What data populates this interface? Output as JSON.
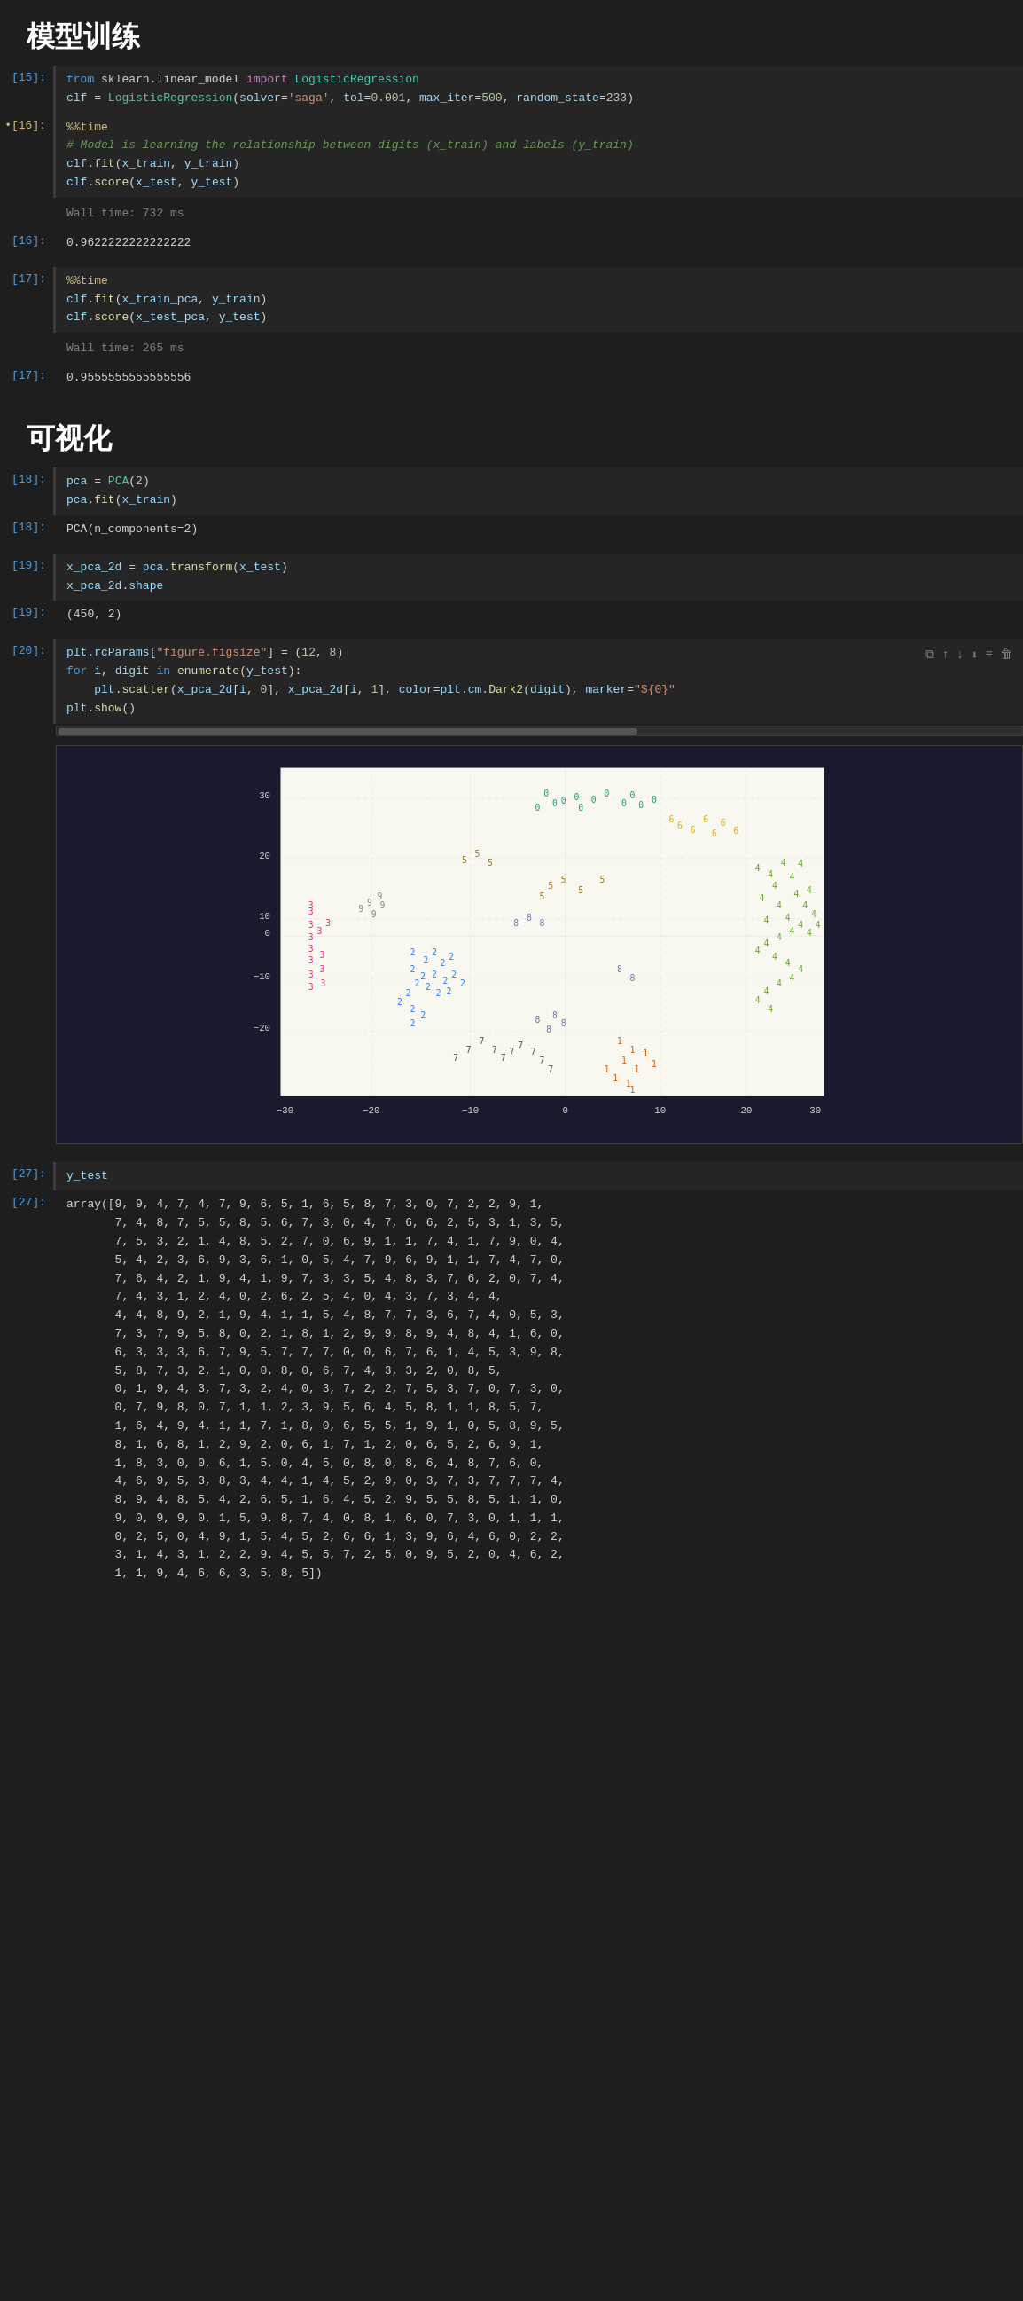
{
  "sections": {
    "training_title": "模型训练",
    "visualization_title": "可视化"
  },
  "cells": {
    "c15_label": "[15]:",
    "c15_code": [
      "from sklearn.linear_model import LogisticRegression",
      "clf = LogisticRegression(solver='saga', tol=0.001, max_iter=500, random_state=233)"
    ],
    "c16_label_in": "•[16]:",
    "c16_code": [
      "%%time",
      "# Model is learning the relationship between digits (x_train) and labels (y_train)",
      "clf.fit(x_train, y_train)",
      "clf.score(x_test, y_test)"
    ],
    "c16_wall": "Wall time: 732 ms",
    "c16_out_label": "[16]:",
    "c16_out": "0.9622222222222222",
    "c17_label": "[17]:",
    "c17_code": [
      "%%time",
      "clf.fit(x_train_pca, y_train)",
      "clf.score(x_test_pca, y_test)"
    ],
    "c17_wall": "Wall time: 265 ms",
    "c17_out_label": "[17]:",
    "c17_out": "0.9555555555555556",
    "c18_label": "[18]:",
    "c18_code": [
      "pca = PCA(2)",
      "pca.fit(x_train)"
    ],
    "c18_out_label": "[18]:",
    "c18_out": "PCA(n_components=2)",
    "c19_label": "[19]:",
    "c19_code": [
      "x_pca_2d = pca.transform(x_test)",
      "x_pca_2d.shape"
    ],
    "c19_out_label": "[19]:",
    "c19_out": "(450, 2)",
    "c20_label": "[20]:",
    "c20_code": [
      "plt.rcParams[\"figure.figsize\"] = (12, 8)",
      "for i, digit in enumerate(y_test):",
      "    plt.scatter(x_pca_2d[i, 0], x_pca_2d[i, 1], color=plt.cm.Dark2(digit), marker=\"${0}\"",
      "plt.show()"
    ],
    "c27_label": "[27]:",
    "c27_code": "y_test",
    "c27_out_label": "[27]:",
    "c27_out": "array([9, 9, 4, 7, 4, 7, 9, 6, 5, 1, 6, 5, 8, 7, 3, 0, 7, 2, 2, 9, 1,\n       7, 4, 8, 7, 5, 5, 8, 5, 6, 7, 3, 0, 4, 7, 6, 6, 2, 5, 3, 1, 3, 5,\n       7, 5, 3, 2, 1, 4, 8, 5, 2, 7, 0, 6, 9, 1, 1, 7, 4, 1, 7, 9, 0, 4,\n       5, 4, 2, 3, 6, 9, 3, 6, 1, 0, 5, 4, 7, 9, 6, 9, 1, 1, 7, 4, 7, 0,\n       7, 6, 4, 2, 1, 9, 4, 1, 9, 7, 3, 3, 5, 4, 8, 3, 7, 6, 2, 0, 7, 4,\n       7, 4, 3, 1, 2, 4, 0, 2, 6, 2, 5, 4, 0, 4, 3, 7, 3, 4, 4,\n       4, 4, 8, 9, 2, 1, 9, 4, 1, 1, 5, 4, 8, 7, 7, 3, 6, 7, 4, 0, 5, 3,\n       7, 3, 7, 9, 5, 8, 0, 2, 1, 8, 1, 2, 9, 9, 8, 9, 4, 8, 4, 1, 6, 0,\n       6, 3, 3, 3, 6, 7, 9, 5, 7, 7, 7, 0, 0, 6, 7, 6, 1, 4, 5, 3, 9, 8,\n       5, 8, 7, 3, 2, 1, 0, 0, 8, 0, 6, 7, 4, 3, 3, 2, 0, 8, 5,\n       0, 1, 9, 4, 3, 7, 3, 2, 4, 0, 3, 7, 2, 2, 7, 5, 3, 7, 0, 7, 3, 0,\n       0, 7, 9, 8, 0, 7, 1, 1, 2, 3, 9, 5, 6, 4, 5, 8, 1, 1, 8, 5, 7,\n       1, 6, 4, 9, 4, 1, 1, 7, 1, 8, 0, 6, 5, 5, 1, 9, 1, 0, 5, 8, 9, 5,\n       8, 1, 6, 8, 1, 2, 9, 2, 0, 6, 1, 7, 1, 2, 0, 6, 5, 2, 6, 9, 1,\n       1, 8, 3, 0, 0, 6, 1, 5, 0, 4, 5, 0, 8, 0, 8, 6, 4, 8, 7, 6, 0,\n       4, 6, 9, 5, 3, 8, 3, 4, 4, 1, 4, 5, 2, 9, 0, 3, 7, 3, 7, 7, 7, 4,\n       8, 9, 4, 8, 5, 4, 2, 6, 5, 1, 6, 4, 5, 2, 9, 5, 5, 8, 5, 1, 1, 0,\n       9, 0, 9, 9, 0, 1, 5, 9, 8, 7, 4, 0, 8, 1, 6, 0, 7, 3, 0, 1, 1, 1,\n       0, 2, 5, 0, 4, 9, 1, 5, 4, 5, 2, 6, 6, 1, 3, 9, 6, 4, 6, 0, 2, 2,\n       3, 1, 4, 3, 1, 2, 2, 9, 4, 5, 5, 7, 2, 5, 0, 9, 5, 2, 0, 4, 6, 2,\n       1, 1, 9, 4, 6, 6, 3, 5, 8, 5])"
  }
}
